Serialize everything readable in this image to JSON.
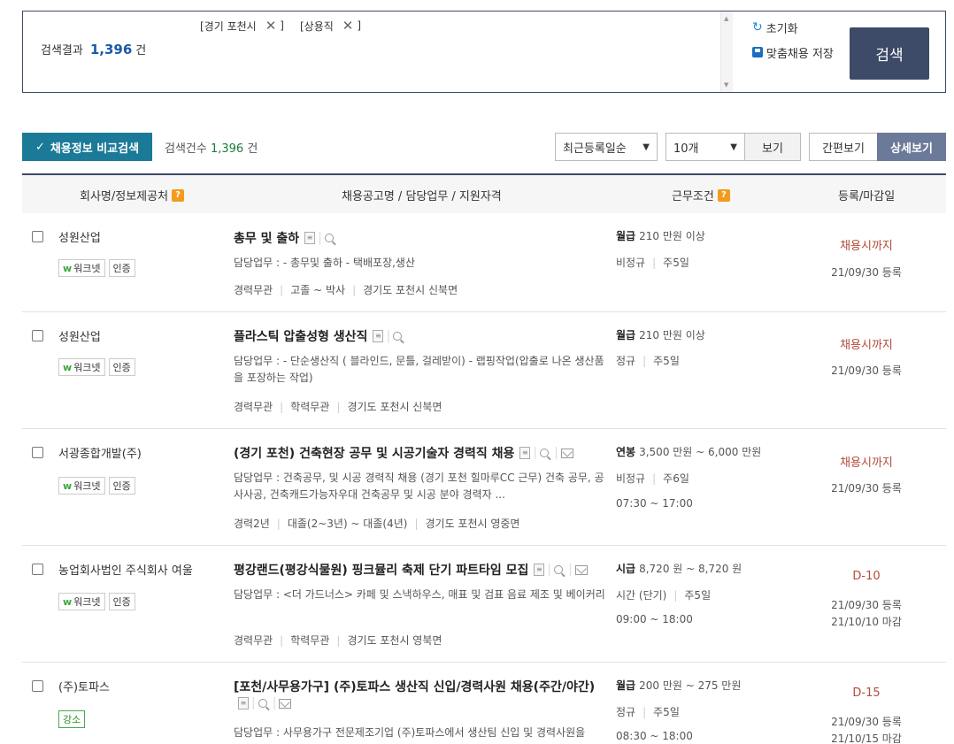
{
  "search": {
    "tags": [
      {
        "label": "[경기 포천시"
      },
      {
        "label": "[상용직"
      }
    ],
    "tag_close": "]",
    "result_label": "검색결과",
    "result_count": "1,396",
    "result_unit": "건",
    "reset_label": "초기화",
    "save_label": "맞춤채용 저장",
    "search_button": "검색"
  },
  "toolbar": {
    "compare_label": "채용정보 비교검색",
    "count_label": "검색건수",
    "count_value": "1,396",
    "count_unit": "건",
    "sort_value": "최근등록일순",
    "size_value": "10개",
    "view_label": "보기",
    "simple_view": "간편보기",
    "detail_view": "상세보기"
  },
  "table": {
    "headers": {
      "company": "회사명/정보제공처",
      "title": "채용공고명 / 담당업무 / 지원자격",
      "condition": "근무조건",
      "date": "등록/마감일"
    },
    "help_glyph": "?",
    "rows": [
      {
        "company": "성원산업",
        "badge1": "워크넷",
        "badge2": "인증",
        "title": "총무 및 출하",
        "duty": "담당업무 : - 총무및 출하 - 택배포장,생산",
        "req1": "경력무관",
        "req2": "고졸 ~ 박사",
        "req3": "경기도 포천시 신북면",
        "pay_type": "월급",
        "pay": "210 만원 이상",
        "cond1": "비정규",
        "cond2": "주5일",
        "hours": "",
        "deadline": "채용시까지",
        "reg": "21/09/30 등록",
        "close": ""
      },
      {
        "company": "성원산업",
        "badge1": "워크넷",
        "badge2": "인증",
        "title": "플라스틱 압출성형 생산직",
        "duty": "담당업무 : - 단순생산직 ( 블라인드, 문틀, 걸레받이) - 랩핑작업(압출로 나온 생산품을 포장하는 작업)",
        "req1": "경력무관",
        "req2": "학력무관",
        "req3": "경기도 포천시 신북면",
        "pay_type": "월급",
        "pay": "210 만원 이상",
        "cond1": "정규",
        "cond2": "주5일",
        "hours": "",
        "deadline": "채용시까지",
        "reg": "21/09/30 등록",
        "close": ""
      },
      {
        "company": "서광종합개발(주)",
        "badge1": "워크넷",
        "badge2": "인증",
        "title": "(경기 포천) 건축현장 공무 및 시공기술자 경력직 채용",
        "duty": "담당업무 : 건축공무, 및 시공 경력직 채용 (경기 포천 힐마루CC 근무) 건축 공무, 공사사공, 건축캐드가능자우대 건축공무 및 시공 분야 경력자 ...",
        "req1": "경력2년",
        "req2": "대졸(2~3년) ~ 대졸(4년)",
        "req3": "경기도 포천시 영중면",
        "pay_type": "연봉",
        "pay": "3,500 만원 ~ 6,000 만원",
        "cond1": "비정규",
        "cond2": "주6일",
        "hours": "07:30 ~ 17:00",
        "deadline": "채용시까지",
        "reg": "21/09/30 등록",
        "close": ""
      },
      {
        "company": "농업회사법인 주식회사 여울",
        "badge1": "워크넷",
        "badge2": "인증",
        "title": "평강랜드(평강식물원) 핑크뮬리 축제 단기 파트타임 모집",
        "duty": "담당업무 : <더 가드너스> 카페 및 스낵하우스, 매표 및 검표 음료 제조 및 베이커리",
        "req1": "경력무관",
        "req2": "학력무관",
        "req3": "경기도 포천시 영북면",
        "pay_type": "시급",
        "pay": "8,720 원 ~ 8,720 원",
        "cond1": "시간 (단기)",
        "cond2": "주5일",
        "hours": "09:00 ~ 18:00",
        "deadline": "D-10",
        "reg": "21/09/30 등록",
        "close": "21/10/10 마감"
      },
      {
        "company": "(주)토파스",
        "badge1": "강소",
        "badge2": "",
        "title": "[포천/사무용가구] (주)토파스 생산직 신입/경력사원 채용(주간/야간)",
        "duty": "담당업무 : 사무용가구 전문제조기업 (주)토파스에서 생산팀 신입 및 경력사원을",
        "req1": "",
        "req2": "",
        "req3": "",
        "pay_type": "월급",
        "pay": "200 만원 ~ 275 만원",
        "cond1": "정규",
        "cond2": "주5일",
        "hours": "08:30 ~ 18:00",
        "deadline": "D-15",
        "reg": "21/09/30 등록",
        "close": "21/10/15 마감"
      }
    ]
  }
}
